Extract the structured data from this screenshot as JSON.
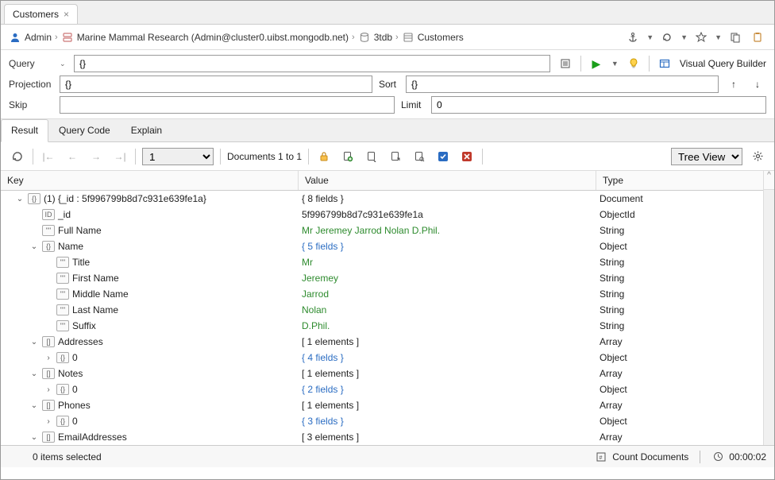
{
  "tab": {
    "title": "Customers"
  },
  "breadcrumb": {
    "user": "Admin",
    "connection": "Marine Mammal Research (Admin@cluster0.uibst.mongodb.net)",
    "db": "3tdb",
    "collection": "Customers"
  },
  "query_section": {
    "query_label": "Query",
    "query_value": "{}",
    "projection_label": "Projection",
    "projection_value": "{}",
    "sort_label": "Sort",
    "sort_value": "{}",
    "skip_label": "Skip",
    "skip_value": "",
    "limit_label": "Limit",
    "limit_value": "0",
    "vqb_label": "Visual Query Builder"
  },
  "result_tabs": {
    "result": "Result",
    "query_code": "Query Code",
    "explain": "Explain"
  },
  "toolbar": {
    "page_value": "1",
    "doc_range": "Documents 1 to 1",
    "view_select": "Tree View"
  },
  "grid_headers": {
    "key": "Key",
    "value": "Value",
    "type": "Type"
  },
  "tree": [
    {
      "indent": 0,
      "expander": "⌄",
      "icon": "{}",
      "key": "(1) {_id : 5f996799b8d7c931e639fe1a}",
      "value": "{ 8 fields }",
      "vclass": "",
      "type": "Document"
    },
    {
      "indent": 1,
      "expander": "",
      "icon": "ID",
      "key": "_id",
      "value": "5f996799b8d7c931e639fe1a",
      "vclass": "",
      "type": "ObjectId"
    },
    {
      "indent": 1,
      "expander": "",
      "icon": "\"\"",
      "key": "Full Name",
      "value": "Mr Jeremey Jarrod Nolan D.Phil.",
      "vclass": "val-green",
      "type": "String"
    },
    {
      "indent": 1,
      "expander": "⌄",
      "icon": "{}",
      "key": "Name",
      "value": "{ 5 fields }",
      "vclass": "val-blue",
      "type": "Object"
    },
    {
      "indent": 2,
      "expander": "",
      "icon": "\"\"",
      "key": "Title",
      "value": "Mr",
      "vclass": "val-green",
      "type": "String"
    },
    {
      "indent": 2,
      "expander": "",
      "icon": "\"\"",
      "key": "First Name",
      "value": "Jeremey",
      "vclass": "val-green",
      "type": "String"
    },
    {
      "indent": 2,
      "expander": "",
      "icon": "\"\"",
      "key": "Middle Name",
      "value": "Jarrod",
      "vclass": "val-green",
      "type": "String"
    },
    {
      "indent": 2,
      "expander": "",
      "icon": "\"\"",
      "key": "Last Name",
      "value": "Nolan",
      "vclass": "val-green",
      "type": "String"
    },
    {
      "indent": 2,
      "expander": "",
      "icon": "\"\"",
      "key": "Suffix",
      "value": "D.Phil.",
      "vclass": "val-green",
      "type": "String"
    },
    {
      "indent": 1,
      "expander": "⌄",
      "icon": "[]",
      "key": "Addresses",
      "value": "[ 1 elements ]",
      "vclass": "",
      "type": "Array"
    },
    {
      "indent": 2,
      "expander": "›",
      "icon": "{}",
      "key": "0",
      "value": "{ 4 fields }",
      "vclass": "val-blue",
      "type": "Object"
    },
    {
      "indent": 1,
      "expander": "⌄",
      "icon": "[]",
      "key": "Notes",
      "value": "[ 1 elements ]",
      "vclass": "",
      "type": "Array"
    },
    {
      "indent": 2,
      "expander": "›",
      "icon": "{}",
      "key": "0",
      "value": "{ 2 fields }",
      "vclass": "val-blue",
      "type": "Object"
    },
    {
      "indent": 1,
      "expander": "⌄",
      "icon": "[]",
      "key": "Phones",
      "value": "[ 1 elements ]",
      "vclass": "",
      "type": "Array"
    },
    {
      "indent": 2,
      "expander": "›",
      "icon": "{}",
      "key": "0",
      "value": "{ 3 fields }",
      "vclass": "val-blue",
      "type": "Object"
    },
    {
      "indent": 1,
      "expander": "⌄",
      "icon": "[]",
      "key": "EmailAddresses",
      "value": "[ 3 elements ]",
      "vclass": "",
      "type": "Array"
    }
  ],
  "status": {
    "selection": "0 items selected",
    "count_docs": "Count Documents",
    "elapsed": "00:00:02"
  }
}
